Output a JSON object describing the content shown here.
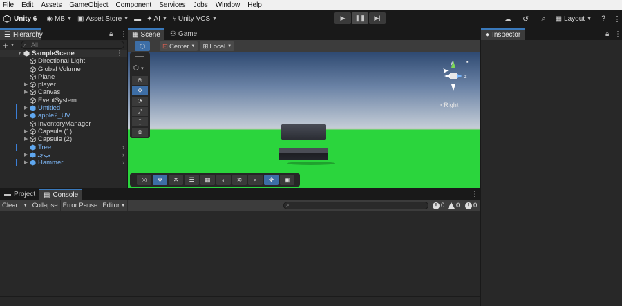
{
  "menu": [
    "File",
    "Edit",
    "Assets",
    "GameObject",
    "Component",
    "Services",
    "Jobs",
    "Window",
    "Help"
  ],
  "toolbar": {
    "app_title": "Unity 6",
    "account": "MB",
    "asset_store": "Asset Store",
    "ai": "AI",
    "vcs": "Unity VCS",
    "layout": "Layout"
  },
  "hierarchy": {
    "tab_label": "Hierarchy",
    "search_placeholder": "All",
    "scene_name": "SampleScene",
    "items": [
      {
        "label": "Directional Light"
      },
      {
        "label": "Global Volume"
      },
      {
        "label": "Plane"
      },
      {
        "label": "player"
      },
      {
        "label": "Canvas"
      },
      {
        "label": "EventSystem"
      },
      {
        "label": "Untitled"
      },
      {
        "label": "apple2_UV"
      },
      {
        "label": "InventoryManager"
      },
      {
        "label": "Capsule (1)"
      },
      {
        "label": "Capsule (2)"
      },
      {
        "label": "Tree"
      },
      {
        "label": "ﺐﺟﺑ"
      },
      {
        "label": "Hammer"
      }
    ]
  },
  "scene": {
    "tab_scene": "Scene",
    "tab_game": "Game",
    "pivot_mode": "Center",
    "pivot_rotation": "Local",
    "gizmo_view": "<Right",
    "gizmo_axis_y": "y",
    "gizmo_axis_z": "z"
  },
  "inspector": {
    "tab_label": "Inspector"
  },
  "console": {
    "tab_project": "Project",
    "tab_console": "Console",
    "clear": "Clear",
    "collapse": "Collapse",
    "error_pause": "Error Pause",
    "editor": "Editor",
    "log_count": "0",
    "warning_count": "0",
    "error_count": "0"
  }
}
